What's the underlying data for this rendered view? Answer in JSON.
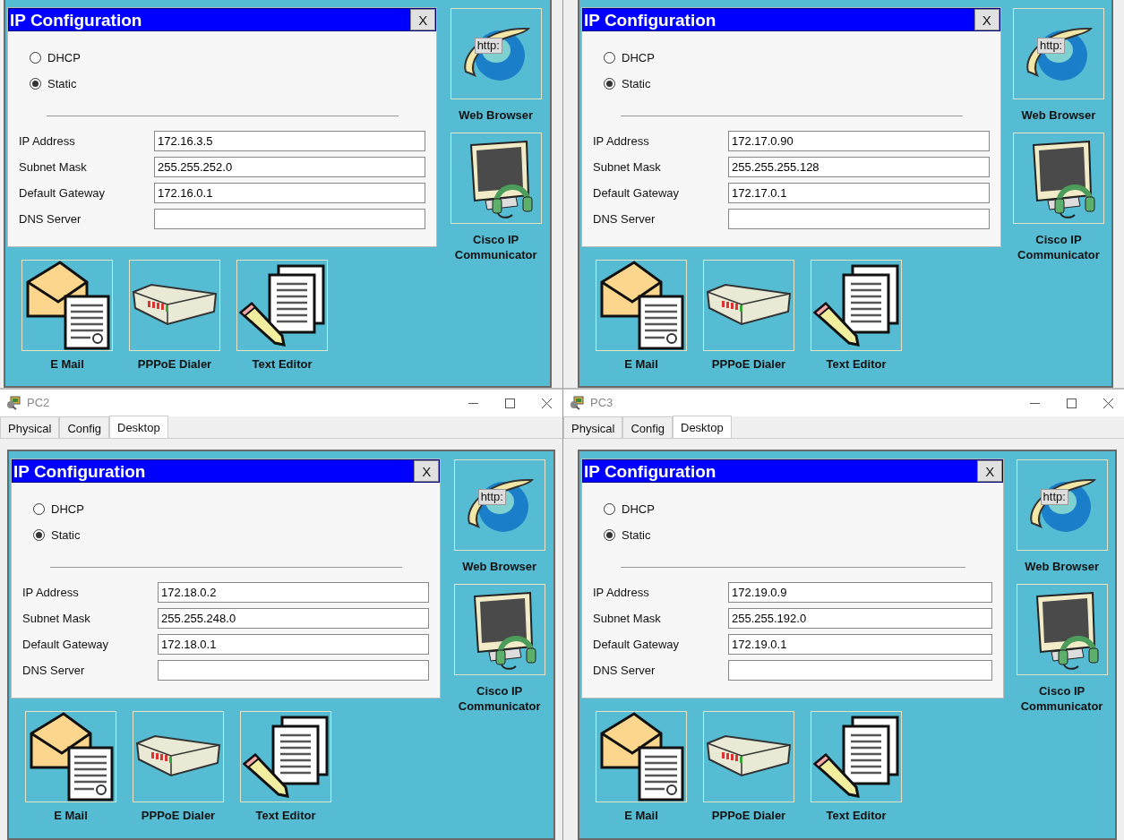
{
  "windows": [
    {
      "dialog": {
        "title": "IP Configuration",
        "close": "X",
        "modes": [
          {
            "label": "DHCP",
            "selected": false
          },
          {
            "label": "Static",
            "selected": true
          }
        ],
        "fields": [
          {
            "label": "IP Address",
            "value": "172.16.3.5"
          },
          {
            "label": "Subnet Mask",
            "value": "255.255.252.0"
          },
          {
            "label": "Default Gateway",
            "value": "172.16.0.1"
          },
          {
            "label": "DNS Server"
          }
        ]
      },
      "side_apps": [
        {
          "label": "Web Browser",
          "kind": "browser",
          "badge": "http:"
        },
        {
          "label": "Cisco IP Communicator",
          "kind": "phone"
        }
      ],
      "bottom_apps": [
        {
          "label": "E Mail",
          "kind": "mail"
        },
        {
          "label": "PPPoE Dialer",
          "kind": "dialer"
        },
        {
          "label": "Text Editor",
          "kind": "editor"
        }
      ]
    },
    {
      "dialog": {
        "title": "IP Configuration",
        "close": "X",
        "modes": [
          {
            "label": "DHCP",
            "selected": false
          },
          {
            "label": "Static",
            "selected": true
          }
        ],
        "fields": [
          {
            "label": "IP Address",
            "value": "172.17.0.90"
          },
          {
            "label": "Subnet Mask",
            "value": "255.255.255.128"
          },
          {
            "label": "Default Gateway",
            "value": "172.17.0.1"
          },
          {
            "label": "DNS Server"
          }
        ]
      },
      "side_apps": [
        {
          "label": "Web Browser",
          "kind": "browser",
          "badge": "http:"
        },
        {
          "label": "Cisco IP Communicator",
          "kind": "phone"
        }
      ],
      "bottom_apps": [
        {
          "label": "E Mail",
          "kind": "mail"
        },
        {
          "label": "PPPoE Dialer",
          "kind": "dialer"
        },
        {
          "label": "Text Editor",
          "kind": "editor"
        }
      ]
    },
    {
      "title": "PC2",
      "tabs": [
        {
          "label": "Physical",
          "selected": false
        },
        {
          "label": "Config",
          "selected": false
        },
        {
          "label": "Desktop",
          "selected": true
        }
      ],
      "dialog": {
        "title": "IP Configuration",
        "close": "X",
        "modes": [
          {
            "label": "DHCP",
            "selected": false
          },
          {
            "label": "Static",
            "selected": true
          }
        ],
        "fields": [
          {
            "label": "IP Address",
            "value": "172.18.0.2"
          },
          {
            "label": "Subnet Mask",
            "value": "255.255.248.0"
          },
          {
            "label": "Default Gateway",
            "value": "172.18.0.1"
          },
          {
            "label": "DNS Server"
          }
        ]
      },
      "side_apps": [
        {
          "label": "Web Browser",
          "kind": "browser",
          "badge": "http:"
        },
        {
          "label": "Cisco IP Communicator",
          "kind": "phone"
        }
      ],
      "bottom_apps": [
        {
          "label": "E Mail",
          "kind": "mail"
        },
        {
          "label": "PPPoE Dialer",
          "kind": "dialer"
        },
        {
          "label": "Text Editor",
          "kind": "editor"
        }
      ]
    },
    {
      "title": "PC3",
      "tabs": [
        {
          "label": "Physical",
          "selected": false
        },
        {
          "label": "Config",
          "selected": false
        },
        {
          "label": "Desktop",
          "selected": true
        }
      ],
      "dialog": {
        "title": "IP Configuration",
        "close": "X",
        "modes": [
          {
            "label": "DHCP",
            "selected": false
          },
          {
            "label": "Static",
            "selected": true
          }
        ],
        "fields": [
          {
            "label": "IP Address",
            "value": "172.19.0.9"
          },
          {
            "label": "Subnet Mask",
            "value": "255.255.192.0"
          },
          {
            "label": "Default Gateway",
            "value": "172.19.0.1"
          },
          {
            "label": "DNS Server"
          }
        ]
      },
      "side_apps": [
        {
          "label": "Web Browser",
          "kind": "browser",
          "badge": "http:"
        },
        {
          "label": "Cisco IP Communicator",
          "kind": "phone"
        }
      ],
      "bottom_apps": [
        {
          "label": "E Mail",
          "kind": "mail"
        },
        {
          "label": "PPPoE Dialer",
          "kind": "dialer"
        },
        {
          "label": "Text Editor",
          "kind": "editor"
        }
      ]
    }
  ]
}
